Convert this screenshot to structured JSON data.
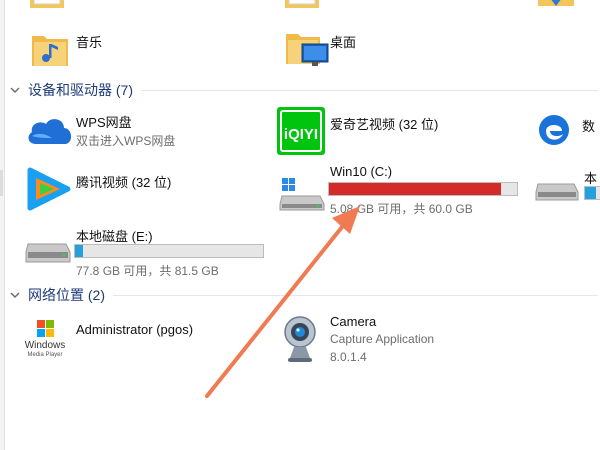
{
  "top_folders": [
    {
      "name": "音乐",
      "icon": "music-folder-icon"
    },
    {
      "name": "桌面",
      "icon": "desktop-folder-icon"
    }
  ],
  "devices_group": {
    "label": "设备和驱动器 (7)"
  },
  "devices": {
    "wps": {
      "name": "WPS网盘",
      "sub": "双击进入WPS网盘"
    },
    "iqiyi": {
      "name": "爱奇艺视频 (32 位)",
      "logo_text": "iQIYI"
    },
    "edge_clip": {
      "name": "数"
    },
    "tencent": {
      "name": "腾讯视频 (32 位)"
    },
    "win10": {
      "name": "Win10 (C:)",
      "sub": "5.08 GB 可用，共 60.0 GB",
      "used_fraction": 0.915
    },
    "local_clip": {
      "name": "本"
    },
    "edrive": {
      "name": "本地磁盘 (E:)",
      "sub": "77.8 GB 可用，共 81.5 GB",
      "used_fraction": 0.045
    }
  },
  "network_group": {
    "label": "网络位置 (2)"
  },
  "network": {
    "admin": {
      "name": "Administrator (pgos)",
      "logo_line1": "Windows",
      "logo_line2": "Media Player"
    },
    "camera": {
      "name": "Camera",
      "sub1": "Capture Application",
      "sub2": "8.0.1.4"
    }
  },
  "colors": {
    "bar_full": "#d42a2a",
    "bar_normal": "#26a0da",
    "arrow": "#f07a52",
    "group_text": "#1e3a78"
  }
}
